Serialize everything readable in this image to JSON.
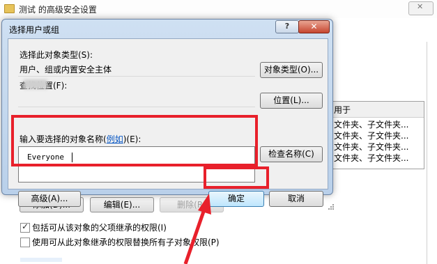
{
  "background_window": {
    "title": "测试 的高级安全设置",
    "list_header": "用于",
    "list_rows": [
      "文件夹、子文件夹...",
      "文件夹、子文件夹...",
      "文件夹、子文件夹...",
      "文件夹、子文件夹..."
    ],
    "buttons": {
      "add": "添加(D)...",
      "edit": "编辑(E)...",
      "remove": "删除(R)"
    },
    "checkbox_inherit": {
      "label": "包括可从该对象的父项继承的权限(I)",
      "checked": true
    },
    "checkbox_replace": {
      "label": "使用可从此对象继承的权限替换所有子对象权限(P)",
      "checked": false
    }
  },
  "dialog": {
    "title": "选择用户或组",
    "object_type_label": "选择此对象类型(S):",
    "object_type_value": "用户、组或内置安全主体",
    "object_type_button": "对象类型(O)...",
    "location_label": "查找位置(F):",
    "location_button": "位置(L)...",
    "names_label_pre": "输入要选择的对象名称(",
    "names_label_link": "例如",
    "names_label_post": ")(E):",
    "names_value": "Everyone",
    "check_names_button": "检查名称(C)",
    "advanced_button": "高级(A)...",
    "ok_button": "确定",
    "cancel_button": "取消"
  },
  "colors": {
    "highlight_red": "#e8202b",
    "link_blue": "#0a58c4",
    "dialog_frame": "#b9d0ea"
  }
}
